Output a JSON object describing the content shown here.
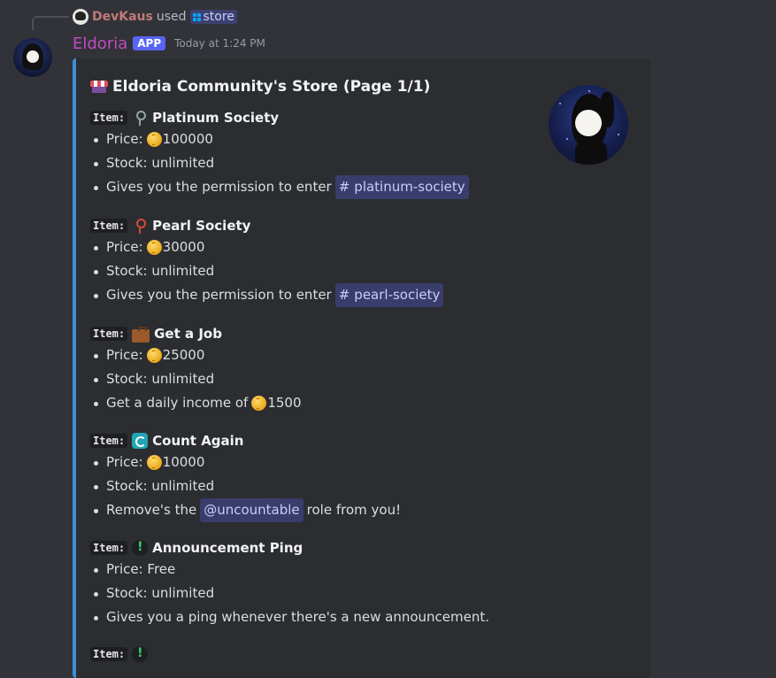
{
  "reply": {
    "user": "DevKaus",
    "used_text": "used",
    "command": "store"
  },
  "message": {
    "bot_name": "Eldoria",
    "badge": "APP",
    "timestamp": "Today at 1:24 PM"
  },
  "embed": {
    "title": "Eldoria Community's Store (Page 1/1)",
    "item_prefix": "Item:",
    "items": [
      {
        "name": "Platinum Society",
        "icon": "key-icon",
        "price_label": "Price:",
        "price": "100000",
        "stock": "Stock: unlimited",
        "desc": "Gives you the permission to enter",
        "mention": "platinum-society"
      },
      {
        "name": "Pearl Society",
        "icon": "key-icon",
        "price_label": "Price:",
        "price": "30000",
        "stock": "Stock: unlimited",
        "desc": "Gives you the permission to enter",
        "mention": "pearl-society"
      },
      {
        "name": "Get a Job",
        "icon": "briefcase-icon",
        "price_label": "Price:",
        "price": "25000",
        "stock": "Stock: unlimited",
        "desc": "Get a daily income of",
        "desc_amount": "1500"
      },
      {
        "name": "Count Again",
        "icon": "repeat-icon",
        "price_label": "Price:",
        "price": "10000",
        "stock": "Stock: unlimited",
        "desc_before": "Remove's the",
        "mention": "@uncountable",
        "desc_after": "role from you!"
      },
      {
        "name": "Announcement Ping",
        "icon": "exclamation-icon",
        "price_text": "Price: Free",
        "stock": "Stock: unlimited",
        "desc": "Gives you a ping whenever there's a new announcement."
      }
    ]
  }
}
